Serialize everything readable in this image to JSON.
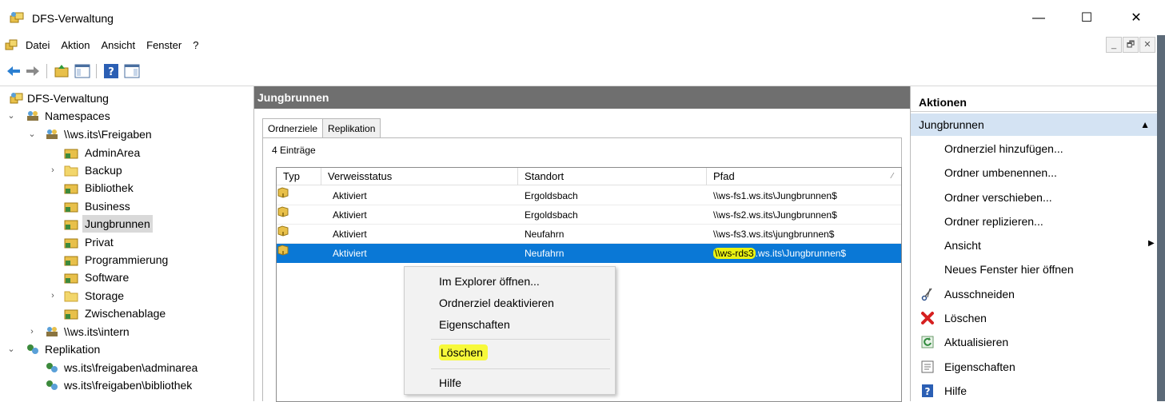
{
  "window": {
    "title": "DFS-Verwaltung",
    "minimize": "—",
    "maximize": "☐",
    "close": "✕"
  },
  "menu": {
    "items": [
      "Datei",
      "Aktion",
      "Ansicht",
      "Fenster",
      "?"
    ],
    "mdi_minimize": "_",
    "mdi_restore": "🗗",
    "mdi_close": "✕"
  },
  "tree": {
    "root": "DFS-Verwaltung",
    "namespaces": "Namespaces",
    "freigaben": "\\\\ws.its\\Freigaben",
    "folders": [
      "AdminArea",
      "Backup",
      "Bibliothek",
      "Business",
      "Jungbrunnen",
      "Privat",
      "Programmierung",
      "Software",
      "Storage",
      "Zwischenablage"
    ],
    "intern": "\\\\ws.its\\intern",
    "replikation": "Replikation",
    "rep_items": [
      "ws.its\\freigaben\\adminarea",
      "ws.its\\freigaben\\bibliothek"
    ],
    "selected": "Jungbrunnen"
  },
  "center": {
    "title": "Jungbrunnen",
    "tabs": [
      "Ordnerziele",
      "Replikation"
    ],
    "active_tab": "Ordnerziele",
    "count": "4 Einträge",
    "columns": [
      "Typ",
      "Verweisstatus",
      "Standort",
      "Pfad"
    ],
    "sort_indicator": "⁄",
    "rows": [
      {
        "status": "Aktiviert",
        "site": "Ergoldsbach",
        "path": "\\\\ws-fs1.ws.its\\Jungbrunnen$"
      },
      {
        "status": "Aktiviert",
        "site": "Ergoldsbach",
        "path": "\\\\ws-fs2.ws.its\\Jungbrunnen$"
      },
      {
        "status": "Aktiviert",
        "site": "Neufahrn",
        "path": "\\\\ws-fs3.ws.its\\jungbrunnen$"
      },
      {
        "status": "Aktiviert",
        "site": "Neufahrn",
        "path_highlight": "\\\\ws-rds3",
        "path_rest": ".ws.its\\Jungbrunnen$"
      }
    ],
    "selected_row": 3
  },
  "context_menu": {
    "items": [
      "Im Explorer öffnen...",
      "Ordnerziel deaktivieren",
      "Eigenschaften",
      "Löschen",
      "Hilfe"
    ],
    "highlighted": "Löschen"
  },
  "actions": {
    "header": "Aktionen",
    "section": "Jungbrunnen",
    "items": [
      "Ordnerziel hinzufügen...",
      "Ordner umbenennen...",
      "Ordner verschieben...",
      "Ordner replizieren...",
      "Ansicht",
      "Neues Fenster hier öffnen",
      "Ausschneiden",
      "Löschen",
      "Aktualisieren",
      "Eigenschaften",
      "Hilfe"
    ]
  },
  "colors": {
    "selection_blue": "#0a78d6",
    "highlight_yellow": "#f7f93a",
    "header_gray": "#6f6f6f",
    "action_section": "#d4e3f3"
  }
}
